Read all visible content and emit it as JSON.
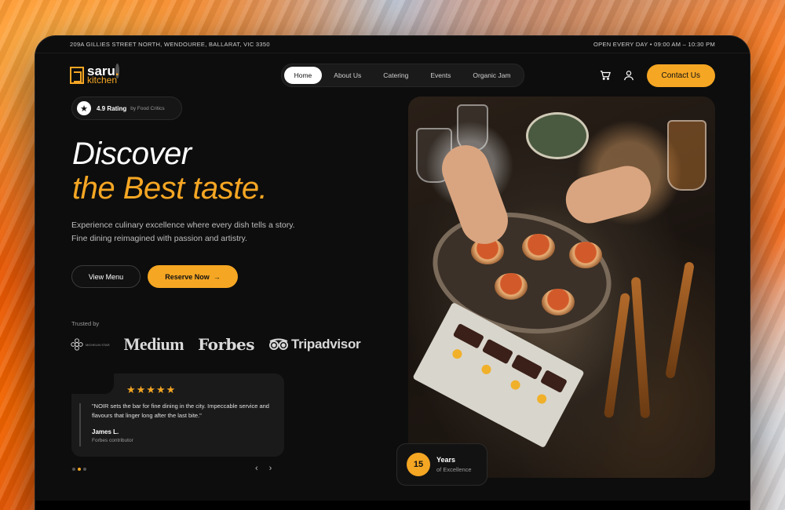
{
  "topbar": {
    "address": "209A GILLIES STREET NORTH, WENDOUREE, BALLARAT, VIC 3350",
    "hours": "OPEN EVERY DAY • 09:00 AM – 10:30 PM"
  },
  "brand": {
    "name": "saru",
    "sub": "kitchen",
    "accent": "#f5a623"
  },
  "nav": {
    "items": [
      {
        "label": "Home",
        "active": true
      },
      {
        "label": "About Us"
      },
      {
        "label": "Catering"
      },
      {
        "label": "Events"
      },
      {
        "label": "Organic Jam"
      }
    ],
    "contact_label": "Contact Us"
  },
  "rating": {
    "value": "4.9 Rating",
    "by": "by Food Critics"
  },
  "hero": {
    "line1": "Discover",
    "line2": "the Best taste.",
    "description": "Experience culinary excellence where every dish tells a story. Fine dining reimagined with passion and artistry.",
    "view_menu": "View Menu",
    "reserve": "Reserve Now"
  },
  "trusted": {
    "label": "Trusted by",
    "logos": [
      "MICHELIN STAR",
      "Medium",
      "Forbes",
      "Tripadvisor"
    ]
  },
  "testimonial": {
    "stars": "★★★★★",
    "quote": "\"NOIR sets the bar for fine dining in the city. Impeccable service and flavours that linger long after the last bite.\"",
    "name": "James L.",
    "role": "Forbes contributor"
  },
  "carousel": {
    "prev": "‹",
    "next": "›"
  },
  "badge": {
    "number": "15",
    "title": "Years",
    "subtitle": "of Excellence"
  }
}
